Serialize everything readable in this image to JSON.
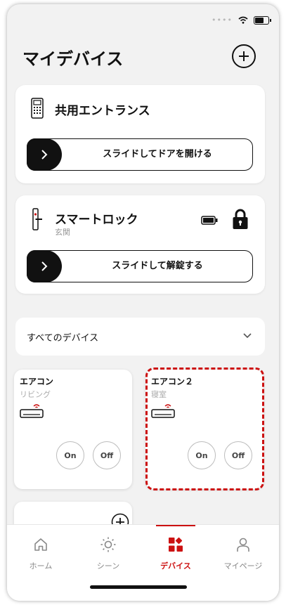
{
  "header": {
    "title": "マイデバイス"
  },
  "entrance": {
    "title": "共用エントランス",
    "slider_label": "スライドしてドアを開ける"
  },
  "lock": {
    "title": "スマートロック",
    "location": "玄関",
    "slider_label": "スライドして解錠する"
  },
  "filter": {
    "label": "すべてのデバイス"
  },
  "devices": [
    {
      "name": "エアコン",
      "room": "リビング",
      "on_label": "On",
      "off_label": "Off"
    },
    {
      "name": "エアコン２",
      "room": "寝室",
      "on_label": "On",
      "off_label": "Off"
    }
  ],
  "tabs": [
    {
      "label": "ホーム",
      "icon": "home-icon"
    },
    {
      "label": "シーン",
      "icon": "sun-icon"
    },
    {
      "label": "デバイス",
      "icon": "devices-icon",
      "active": true
    },
    {
      "label": "マイページ",
      "icon": "person-icon"
    }
  ],
  "colors": {
    "accent": "#cc1111",
    "background": "#f2f2f2",
    "dark": "#111111"
  }
}
